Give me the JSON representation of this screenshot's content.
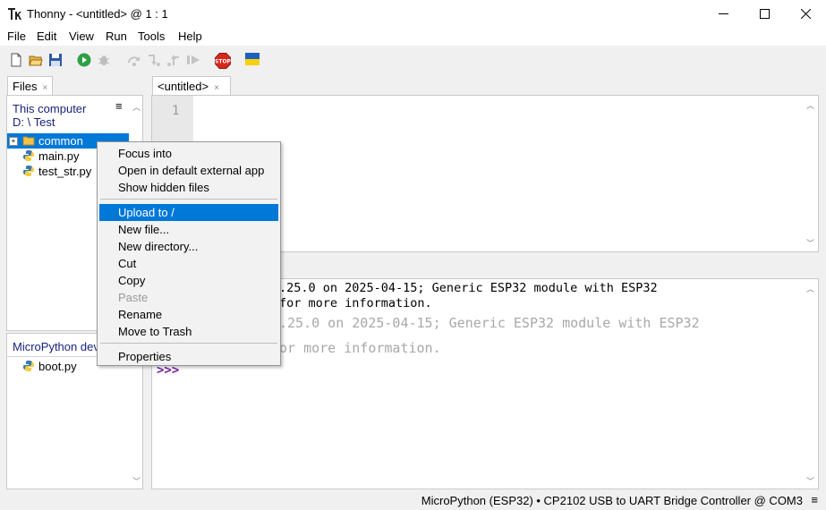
{
  "window": {
    "title": "Thonny  -  <untitled>  @  1 : 1",
    "minimize_glyph": "—",
    "maximize_glyph": "☐",
    "close_glyph": "✕"
  },
  "menu": [
    "File",
    "Edit",
    "View",
    "Run",
    "Tools",
    "Help"
  ],
  "toolbar_icons": [
    "new-file-icon",
    "open-file-icon",
    "save-icon",
    "run-icon",
    "debug-icon",
    "step-over-icon",
    "step-into-icon",
    "step-out-icon",
    "resume-icon",
    "stop-icon",
    "ukraine-flag-icon"
  ],
  "files_panel": {
    "tab_label": "Files",
    "tab_close": "×",
    "location_title": "This computer",
    "location_path": "D: \\ Test",
    "menu_glyph": "≡",
    "items": [
      {
        "name": "common",
        "type": "folder",
        "expander": "+"
      },
      {
        "name": "main.py",
        "type": "python"
      },
      {
        "name": "test_str.py",
        "type": "python"
      }
    ],
    "device_title": "MicroPython device",
    "device_items": [
      {
        "name": "boot.py",
        "type": "python"
      }
    ]
  },
  "editor": {
    "tab_label": "<untitled>",
    "tab_close": "×",
    "line_number": "1"
  },
  "shell": {
    "lines": [
      ".25.0 on 2025-04-15; Generic ESP32 module with ESP32",
      "for more information.",
      ".25.0 on 2025-04-15; Generic ESP32 module with ESP32",
      "or more information."
    ],
    "prompt": ">>>"
  },
  "context_menu": {
    "groups": [
      [
        "Focus into",
        "Open in default external app",
        "Show hidden files"
      ],
      [
        "Upload to /",
        "New file...",
        "New directory...",
        "Cut",
        "Copy",
        "Paste",
        "Rename",
        "Move to Trash"
      ],
      [
        "Properties"
      ]
    ],
    "selected": "Upload to /",
    "disabled": [
      "Paste"
    ]
  },
  "status": {
    "text": "MicroPython (ESP32)  •  CP2102 USB to UART Bridge Controller @ COM3",
    "menu_glyph": "≡"
  },
  "colors": {
    "selection": "#0078d7",
    "prompt": "#7a1fa2",
    "location_text": "#1a237e"
  }
}
